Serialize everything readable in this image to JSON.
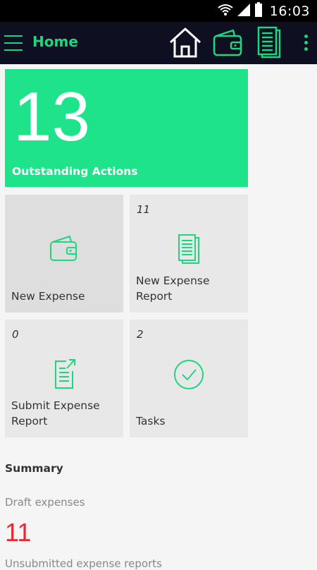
{
  "status_bar": {
    "time": "16:03",
    "icons": [
      "wifi-icon",
      "signal-icon",
      "battery-icon"
    ]
  },
  "app_bar": {
    "title": "Home",
    "actions": [
      "home-icon",
      "wallet-icon",
      "document-icon",
      "overflow-menu-icon"
    ]
  },
  "outstanding": {
    "count": "13",
    "label": "Outstanding Actions"
  },
  "tiles": [
    {
      "count": "",
      "label": "New Expense",
      "icon": "wallet-icon"
    },
    {
      "count": "11",
      "label": "New Expense Report",
      "icon": "document-icon"
    },
    {
      "count": "0",
      "label": "Submit Expense Report",
      "icon": "submit-document-icon"
    },
    {
      "count": "2",
      "label": "Tasks",
      "icon": "checkmark-circle-icon"
    }
  ],
  "summary": {
    "title": "Summary",
    "draft_label": "Draft expenses",
    "draft_value": "11",
    "next_label": "Unsubmitted expense reports"
  },
  "colors": {
    "accent": "#1ed67f",
    "hero": "#1ee38a",
    "app_bar": "#0f0f22",
    "tile": "#e8e8e8",
    "alert": "#e8282e"
  }
}
